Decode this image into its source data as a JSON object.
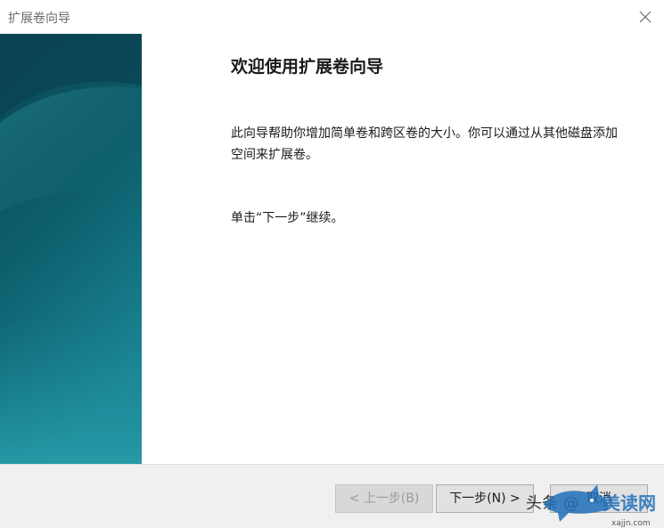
{
  "window": {
    "title": "扩展卷向导"
  },
  "wizard": {
    "heading": "欢迎使用扩展卷向导",
    "description": "此向导帮助你增加简单卷和跨区卷的大小。你可以通过从其他磁盘添加空间来扩展卷。",
    "hint": "单击“下一步”继续。"
  },
  "buttons": {
    "back_label": "< 上一步(B)",
    "next_label": "下一步(N) >",
    "cancel_label": "取消"
  },
  "watermark": {
    "text": "头条 @",
    "logo_text": "美读网",
    "logo_site": "xajjn.com"
  },
  "colors": {
    "side_panel_dark": "#0b4a5a",
    "side_panel_light": "#1f8c9a",
    "footer_bg": "#f0f0f0"
  }
}
